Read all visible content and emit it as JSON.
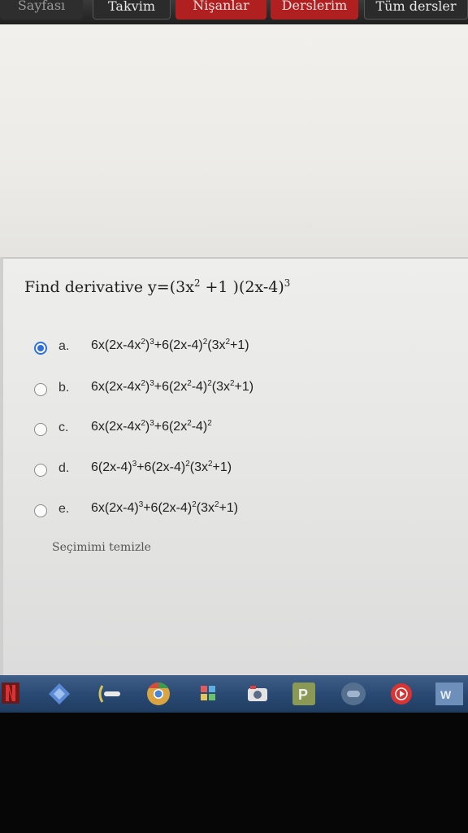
{
  "nav": {
    "partial_left": "Sayfası",
    "calendar": "Takvim",
    "badges": "Nişanlar",
    "my_courses": "Derslerim",
    "all_courses": "Tüm dersler"
  },
  "question": {
    "prefix": "Find derivative y=(3x",
    "exp1": "2",
    "mid": " +1 )(2x-4)",
    "exp2": "3"
  },
  "options": [
    {
      "letter": "a.",
      "selected": true
    },
    {
      "letter": "b.",
      "selected": false
    },
    {
      "letter": "c.",
      "selected": false
    },
    {
      "letter": "d.",
      "selected": false
    },
    {
      "letter": "e.",
      "selected": false
    }
  ],
  "formula_parts": {
    "a": [
      "6x(2x-4x",
      "2",
      ")",
      "3",
      "+6(2x-4)",
      "2",
      "(3x",
      "2",
      "+1)"
    ],
    "b": [
      "6x(2x-4x",
      "2",
      ")",
      "3",
      "+6(2x",
      "2",
      "-4)",
      "2",
      "(3x",
      "2",
      "+1)"
    ],
    "c": [
      "6x(2x-4x",
      "2",
      ")",
      "3",
      "+6(2x",
      "2",
      "-4)",
      "2"
    ],
    "d": [
      "6(2x-4)",
      "3",
      "+6(2x-4)",
      "2",
      "(3x",
      "2",
      "+1)"
    ],
    "e": [
      "6x(2x-4)",
      "3",
      "+6(2x-4)",
      "2",
      "(3x",
      "2",
      "+1)"
    ]
  },
  "clear_selection": "Seçimimi temizle",
  "taskbar_icons": [
    "netflix-icon",
    "kodi-icon",
    "app-icon",
    "chrome-icon",
    "flower-icon",
    "camera-icon",
    "plex-icon",
    "gamepad-icon",
    "youtube-music-icon",
    "word-icon"
  ],
  "colors": {
    "accent_radio": "#2f6fd8",
    "nav_red": "#b02020",
    "taskbar": "#2a4a74"
  }
}
